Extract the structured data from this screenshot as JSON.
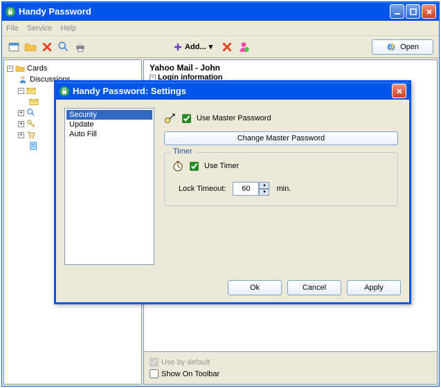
{
  "app": {
    "title": "Handy Password"
  },
  "menu": {
    "file": "File",
    "service": "Service",
    "help": "Help"
  },
  "toolbar": {
    "add": "Add...",
    "open": "Open"
  },
  "tree": {
    "root": "Cards",
    "discussions": "Discussions"
  },
  "info": {
    "title": "Yahoo Mail - John",
    "login_section": "Login information"
  },
  "bottom": {
    "use_default": "Use by default",
    "show_toolbar": "Show On Toolbar"
  },
  "dialog": {
    "title": "Handy Password: Settings",
    "categories": [
      "Security",
      "Update",
      "Auto Fill"
    ],
    "use_master": "Use Master Password",
    "change_master": "Change Master Password",
    "timer_legend": "Timer",
    "use_timer": "Use Timer",
    "lock_timeout_label": "Lock Timeout:",
    "lock_timeout_value": "60",
    "timeout_unit": "min.",
    "ok": "Ok",
    "cancel": "Cancel",
    "apply": "Apply"
  }
}
